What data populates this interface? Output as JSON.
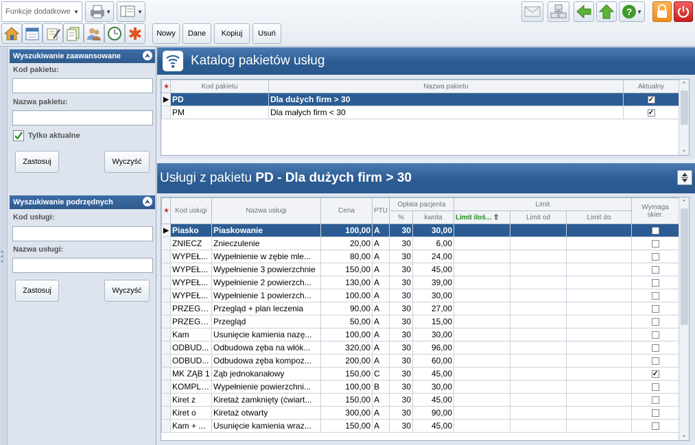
{
  "toolbar": {
    "functions_combo": "Funkcje dodatkowe",
    "buttons": {
      "new": "Nowy",
      "edit": "Dane",
      "copy": "Kopiuj",
      "delete": "Usuń"
    }
  },
  "advanced_search": {
    "title": "Wyszukiwanie zaawansowane",
    "code_label": "Kod pakietu:",
    "code_value": "",
    "name_label": "Nazwa pakietu:",
    "name_value": "",
    "only_current_label": "Tylko aktualne",
    "only_current_checked": true,
    "apply": "Zastosuj",
    "clear": "Wyczyść"
  },
  "sub_search": {
    "title": "Wyszukiwanie podrzędnych",
    "code_label": "Kod usługi:",
    "code_value": "",
    "name_label": "Nazwa usługi:",
    "name_value": "",
    "apply": "Zastosuj",
    "clear": "Wyczyść"
  },
  "catalog": {
    "title": "Katalog pakietów usług",
    "columns": {
      "code": "Kod pakietu",
      "name": "Nazwa pakietu",
      "current": "Aktualny"
    },
    "rows": [
      {
        "code": "PD",
        "name": "Dla dużych firm > 30",
        "current": true,
        "selected": true
      },
      {
        "code": "PM",
        "name": "Dla małych firm < 30",
        "current": true,
        "selected": false
      }
    ]
  },
  "services": {
    "title_prefix": "Usługi z pakietu",
    "title_code": "PD",
    "title_sep": "-",
    "title_name": "Dla dużych firm > 30",
    "columns": {
      "code": "Kod usługi",
      "name": "Nazwa usługi",
      "price": "Cena",
      "ptu": "PTU",
      "payment_group": "Opłata pacjenta",
      "percent": "%",
      "amount": "kwota",
      "limit_group": "Limit",
      "limit_qty": "Limit iloś...",
      "limit_from": "Limit od",
      "limit_to": "Limit do",
      "referral_line1": "Wymaga",
      "referral_line2": "skier."
    },
    "rows": [
      {
        "code": "Piasko",
        "name": "Piaskowanie",
        "price": "100,00",
        "ptu": "A",
        "pct": "30",
        "amount": "30,00",
        "referral": false,
        "selected": true
      },
      {
        "code": "ZNIECZ",
        "name": "Znieczulenie",
        "price": "20,00",
        "ptu": "A",
        "pct": "30",
        "amount": "6,00",
        "referral": false
      },
      {
        "code": "WYPEŁ...",
        "name": "Wypełnienie w zębie mle...",
        "price": "80,00",
        "ptu": "A",
        "pct": "30",
        "amount": "24,00",
        "referral": false
      },
      {
        "code": "WYPEŁ...",
        "name": "Wypełnienie 3 powierzchnie",
        "price": "150,00",
        "ptu": "A",
        "pct": "30",
        "amount": "45,00",
        "referral": false
      },
      {
        "code": "WYPEŁ...",
        "name": "Wypełnienie 2 powierzch...",
        "price": "130,00",
        "ptu": "A",
        "pct": "30",
        "amount": "39,00",
        "referral": false
      },
      {
        "code": "WYPEŁ...",
        "name": "Wypełnienie 1 powierzch...",
        "price": "100,00",
        "ptu": "A",
        "pct": "30",
        "amount": "30,00",
        "referral": false
      },
      {
        "code": "PRZEGL...",
        "name": "Przegląd + plan leczenia",
        "price": "90,00",
        "ptu": "A",
        "pct": "30",
        "amount": "27,00",
        "referral": false
      },
      {
        "code": "PRZEGL...",
        "name": "Przegląd",
        "price": "50,00",
        "ptu": "A",
        "pct": "30",
        "amount": "15,00",
        "referral": false
      },
      {
        "code": "Kam",
        "name": "Usunięcie kamienia nazę...",
        "price": "100,00",
        "ptu": "A",
        "pct": "30",
        "amount": "30,00",
        "referral": false
      },
      {
        "code": "ODBUD...",
        "name": "Odbudowa zęba na włók...",
        "price": "320,00",
        "ptu": "A",
        "pct": "30",
        "amount": "96,00",
        "referral": false
      },
      {
        "code": "ODBUD...",
        "name": "Odbudowa zęba kompoz...",
        "price": "200,00",
        "ptu": "A",
        "pct": "30",
        "amount": "60,00",
        "referral": false
      },
      {
        "code": "MK ZĄB 1",
        "name": "Ząb jednokanałowy",
        "price": "150,00",
        "ptu": "C",
        "pct": "30",
        "amount": "45,00",
        "referral": true
      },
      {
        "code": "KOMPLE...",
        "name": "Wypełnienie powierzchni...",
        "price": "100,00",
        "ptu": "B",
        "pct": "30",
        "amount": "30,00",
        "referral": false
      },
      {
        "code": "Kiret z",
        "name": "Kiretaż zamknięty (ćwiart...",
        "price": "150,00",
        "ptu": "A",
        "pct": "30",
        "amount": "45,00",
        "referral": false
      },
      {
        "code": "Kiret o",
        "name": "Kiretaż otwarty",
        "price": "300,00",
        "ptu": "A",
        "pct": "30",
        "amount": "90,00",
        "referral": false
      },
      {
        "code": "Kam + ...",
        "name": "Usunięcie kamienia wraz...",
        "price": "150,00",
        "ptu": "A",
        "pct": "30",
        "amount": "45,00",
        "referral": false
      }
    ]
  },
  "colors": {
    "header_blue": "#2b5c93",
    "limit_qty_green": "#1f8a1f"
  }
}
